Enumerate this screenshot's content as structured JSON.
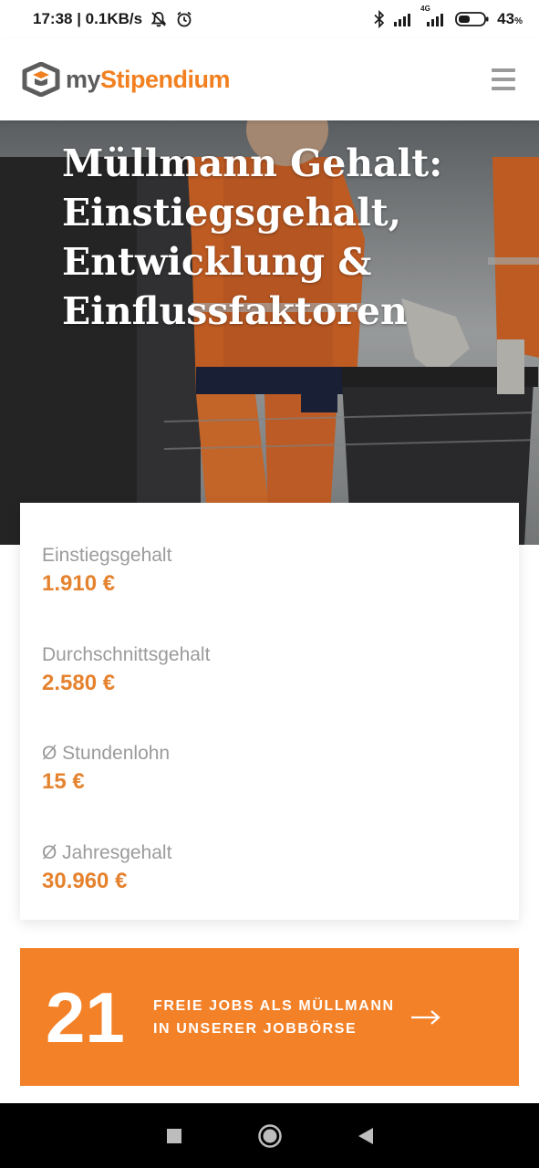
{
  "status_bar": {
    "time_speed": "17:38 | 0.1KB/s",
    "network_label": "4G",
    "battery": "43",
    "battery_unit": "%",
    "icons": [
      "mute-icon",
      "alarm-icon",
      "bluetooth-icon",
      "signal-icon",
      "battery-icon"
    ]
  },
  "header": {
    "logo_part1": "my",
    "logo_part2": "Stipendium",
    "menu_icon": "hamburger-menu-icon"
  },
  "hero": {
    "title_lines": [
      "Müllmann Gehalt:",
      "Einstiegsgehalt,",
      "Entwicklung &",
      "Einflussfaktoren"
    ]
  },
  "stats": [
    {
      "label": "Einstiegsgehalt",
      "value": "1.910 €"
    },
    {
      "label": "Durchschnittsgehalt",
      "value": "2.580 €"
    },
    {
      "label": "Ø Stundenlohn",
      "value": "15 €"
    },
    {
      "label": "Ø Jahresgehalt",
      "value": "30.960 €"
    }
  ],
  "jobs_banner": {
    "count": "21",
    "line1": "FREIE JOBS ALS MÜLLMANN",
    "line2": "IN UNSERER JOBBÖRSE",
    "arrow_icon": "arrow-right-icon"
  },
  "colors": {
    "brand_orange": "#f38128",
    "stat_value": "#e5822e",
    "stat_label": "#9b9b9b"
  },
  "nav": [
    "recents-square-icon",
    "home-circle-icon",
    "back-triangle-icon"
  ]
}
